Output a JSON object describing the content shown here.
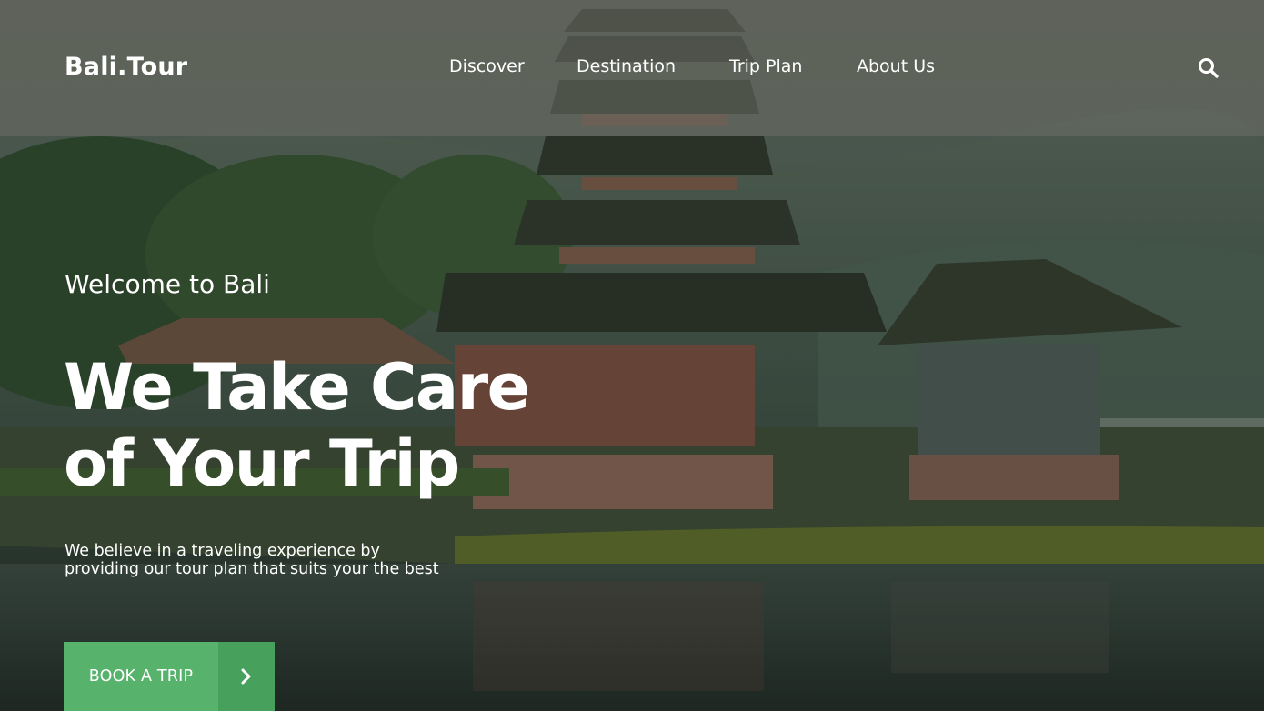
{
  "header": {
    "logo": "Bali.Tour",
    "nav": [
      {
        "label": "Discover"
      },
      {
        "label": "Destination"
      },
      {
        "label": "Trip Plan"
      },
      {
        "label": "About Us"
      }
    ],
    "search_icon": "search-icon"
  },
  "hero": {
    "welcome": "Welcome to Bali",
    "headline_line1": "We Take Care",
    "headline_line2": "of Your Trip",
    "lead": "We believe in a traveling experience by providing our tour plan that suits your the best",
    "cta_label": "BOOK A TRIP",
    "cta_icon": "chevron-right-icon",
    "accent": "#57b26c",
    "accent_dark": "#47a05c"
  }
}
